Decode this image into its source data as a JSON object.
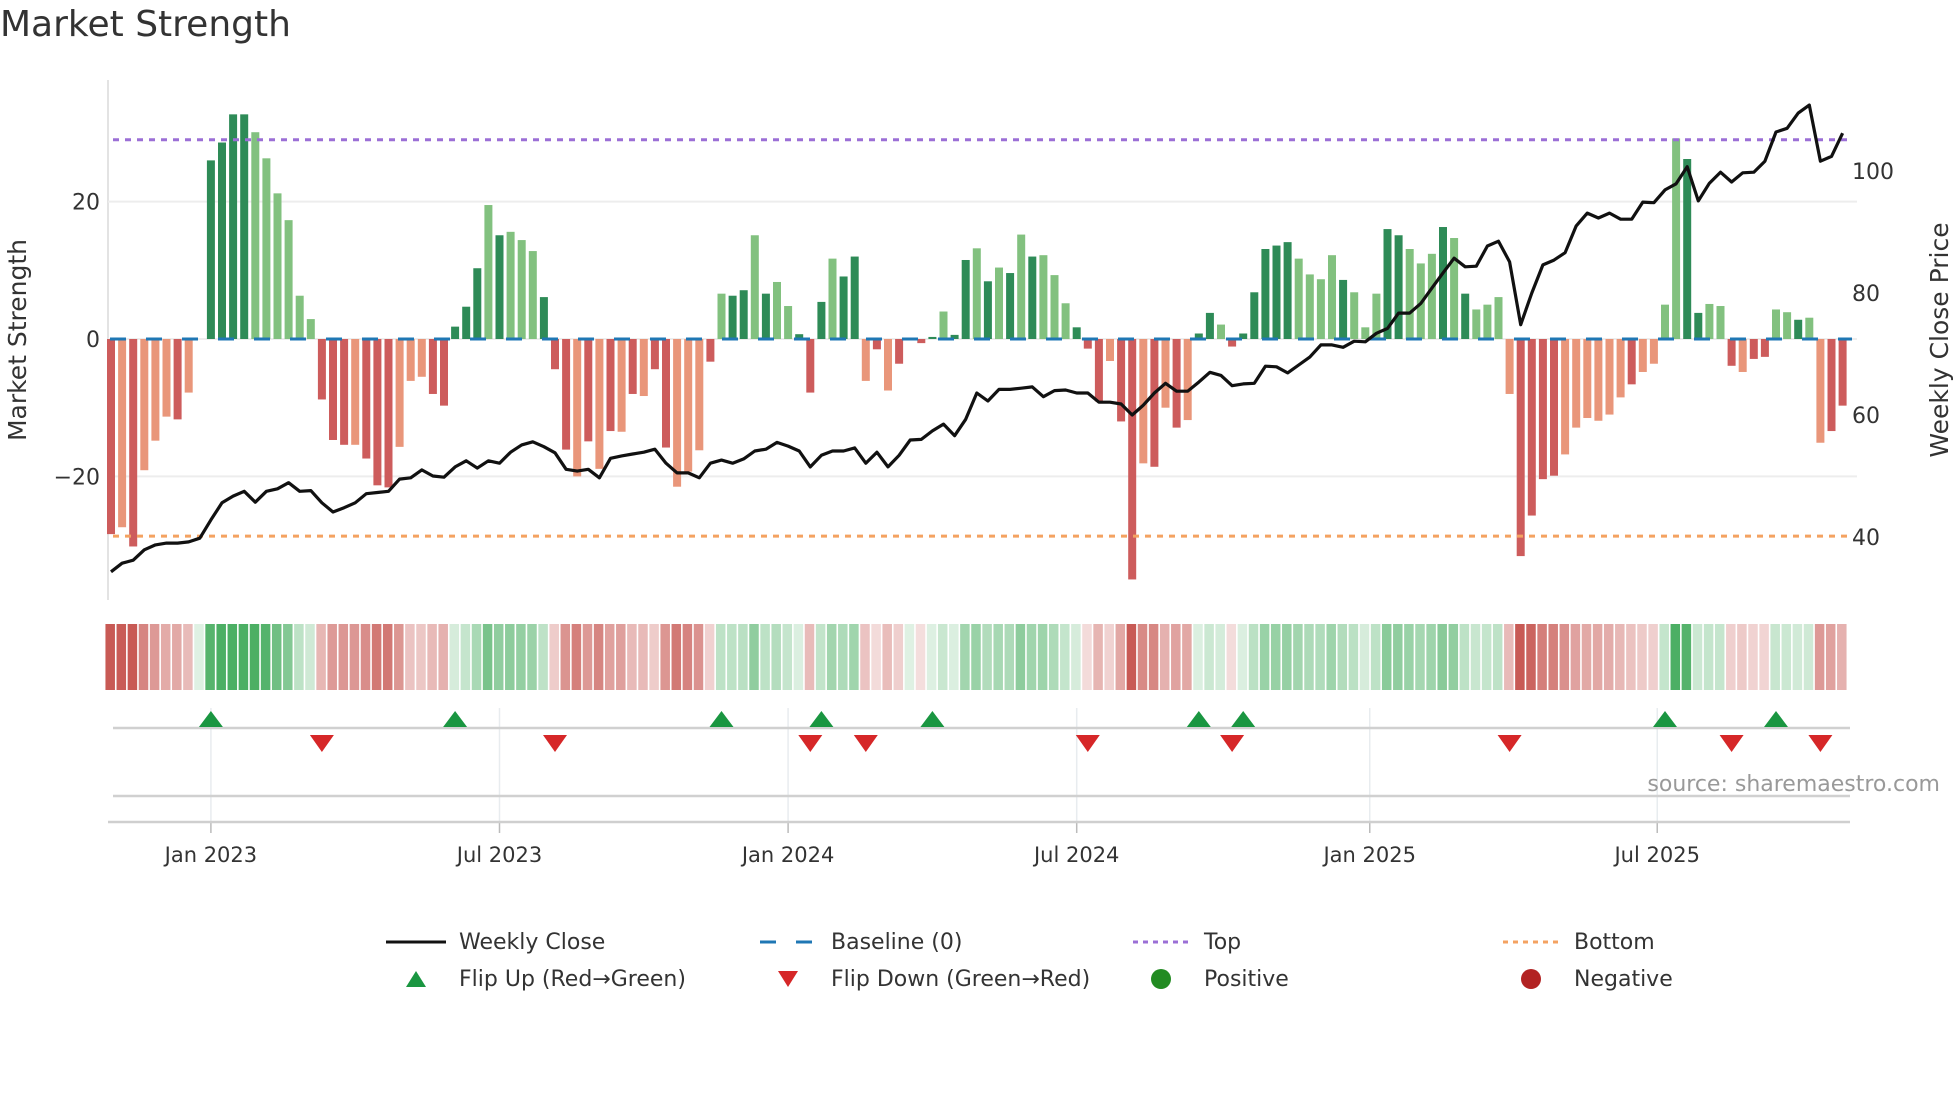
{
  "title": "Market Strength",
  "source": "source: sharemaestro.com",
  "colors": {
    "pos_dark": "#2e8b57",
    "pos_light": "#82c17f",
    "neg_dark": "#cd5c5c",
    "neg_light": "#e9967a",
    "baseline": "#1f77b4",
    "top": "#9b6fd6",
    "bottom": "#f4a261",
    "close": "#111111",
    "flip_up": "#1a9641",
    "flip_down": "#d62728",
    "positive": "#228b22",
    "negative": "#b22222"
  },
  "legend": [
    {
      "label": "Weekly Close",
      "symbol": "solid-line"
    },
    {
      "label": "Baseline (0)",
      "symbol": "dashed-line"
    },
    {
      "label": "Top",
      "symbol": "dotted-line-purple"
    },
    {
      "label": "Bottom",
      "symbol": "dotted-line-orange"
    },
    {
      "label": "Flip Up (Red→Green)",
      "symbol": "triangle-up"
    },
    {
      "label": "Flip Down (Green→Red)",
      "symbol": "triangle-down"
    },
    {
      "label": "Positive",
      "symbol": "circle-green"
    },
    {
      "label": "Negative",
      "symbol": "circle-red"
    }
  ],
  "chart_data": {
    "type": "bar+line",
    "title": "Market Strength",
    "x_unit": "week index (weekly bars, late Oct 2022 – late Oct 2025)",
    "x_ticks": [
      {
        "label": "Jan 2023",
        "x": 9
      },
      {
        "label": "Jul 2023",
        "x": 35
      },
      {
        "label": "Jan 2024",
        "x": 61
      },
      {
        "label": "Jul 2024",
        "x": 87
      },
      {
        "label": "Jan 2025",
        "x": 113.4
      },
      {
        "label": "Jul 2025",
        "x": 139.3
      }
    ],
    "y_left": {
      "label": "Market Strength",
      "range": [
        -38,
        37.4
      ],
      "ticks": [
        {
          "v": 20,
          "label": "20"
        },
        {
          "v": 0,
          "label": "0"
        },
        {
          "v": -20,
          "label": "−20"
        }
      ]
    },
    "y_right": {
      "label": "Weekly Close Price",
      "range": [
        29.7,
        114.6
      ],
      "ticks": [
        {
          "v": 100,
          "label": "100"
        },
        {
          "v": 80,
          "label": "80"
        },
        {
          "v": 60,
          "label": "60"
        },
        {
          "v": 40,
          "label": "40"
        }
      ]
    },
    "top_level": 29,
    "bottom_level": -28.7,
    "grid": true,
    "legend_placement": "bottom-center",
    "strength": [
      -28.4,
      -27.4,
      -30.2,
      -19.1,
      -14.8,
      -11.3,
      -11.7,
      -7.8,
      0,
      26.0,
      28.6,
      32.7,
      32.7,
      30.1,
      26.3,
      21.2,
      17.3,
      6.3,
      2.9,
      -8.8,
      -14.7,
      -15.4,
      -15.4,
      -17.4,
      -21.3,
      -21.6,
      -15.7,
      -6.1,
      -5.5,
      -8.0,
      -9.7,
      1.8,
      4.7,
      10.3,
      19.5,
      15.1,
      15.6,
      14.4,
      12.8,
      6.1,
      -4.4,
      -16.1,
      -20.0,
      -14.9,
      -18.9,
      -13.4,
      -13.5,
      -8.0,
      -8.3,
      -4.4,
      -15.8,
      -21.5,
      -19.3,
      -16.2,
      -3.3,
      6.6,
      6.3,
      7.1,
      15.1,
      6.6,
      8.3,
      4.8,
      0.7,
      -7.8,
      5.4,
      11.7,
      9.1,
      12.0,
      -6.1,
      -1.5,
      -7.5,
      -3.6,
      0,
      -0.6,
      0.3,
      4.0,
      0.6,
      11.5,
      13.2,
      8.4,
      10.4,
      9.6,
      15.2,
      12.0,
      12.2,
      9.3,
      5.2,
      1.7,
      -1.4,
      -9.1,
      -3.2,
      -12.0,
      -35.0,
      -18.1,
      -18.6,
      -10.0,
      -12.9,
      -11.8,
      0.8,
      3.8,
      2.1,
      -1.1,
      0.8,
      6.8,
      13.1,
      13.6,
      14.1,
      11.7,
      9.4,
      8.7,
      12.2,
      8.6,
      6.8,
      1.7,
      6.6,
      16.0,
      15.1,
      13.1,
      11.0,
      12.4,
      16.3,
      14.7,
      6.6,
      4.3,
      5.0,
      6.1,
      -8.0,
      -31.6,
      -25.7,
      -20.4,
      -19.9,
      -16.8,
      -12.9,
      -11.5,
      -11.9,
      -11.0,
      -8.5,
      -6.6,
      -4.8,
      -3.6,
      5.0,
      29.2,
      26.2,
      3.8,
      5.1,
      4.8,
      -3.9,
      -4.8,
      -2.9,
      -2.6,
      4.3,
      3.9,
      2.8,
      3.1,
      -15.1,
      -13.4,
      -9.7
    ],
    "shade": "dldllldl-ddddlllllldddldddllldddddldllldddldldldlddllldlddldlldddlddldl-dddlddldldldllldddlddldldlddlddddddlllldlllddllldldllllddddlllllldllllddlldlddlldllddll",
    "close": [
      34.3,
      35.7,
      36.2,
      37.9,
      38.7,
      39.0,
      39.0,
      39.2,
      39.8,
      42.8,
      45.6,
      46.7,
      47.5,
      45.7,
      47.5,
      47.9,
      48.9,
      47.5,
      47.6,
      45.6,
      44.1,
      44.8,
      45.6,
      47.1,
      47.3,
      47.5,
      49.5,
      49.7,
      51.0,
      50.0,
      49.8,
      51.5,
      52.5,
      51.3,
      52.5,
      52.1,
      53.9,
      55.1,
      55.6,
      54.8,
      53.8,
      51.1,
      50.8,
      51.1,
      49.7,
      52.9,
      53.3,
      53.6,
      53.9,
      54.4,
      52.1,
      50.5,
      50.5,
      49.7,
      52.1,
      52.6,
      52.1,
      52.8,
      54.1,
      54.4,
      55.5,
      54.9,
      54.1,
      51.5,
      53.4,
      54.1,
      54.1,
      54.6,
      52.1,
      53.9,
      51.5,
      53.4,
      55.9,
      56.0,
      57.4,
      58.5,
      56.6,
      59.3,
      63.6,
      62.3,
      64.2,
      64.2,
      64.4,
      64.6,
      63.0,
      64.0,
      64.1,
      63.6,
      63.6,
      62.1,
      62.1,
      61.8,
      60.0,
      61.6,
      63.6,
      65.2,
      63.9,
      63.9,
      65.4,
      67.0,
      66.5,
      64.8,
      65.1,
      65.2,
      68.0,
      67.9,
      66.9,
      68.2,
      69.5,
      71.5,
      71.5,
      71.1,
      72.1,
      72.0,
      73.4,
      74.2,
      76.7,
      76.7,
      78.3,
      80.8,
      83.3,
      85.7,
      84.3,
      84.4,
      87.7,
      88.5,
      85.1,
      74.8,
      80.0,
      84.6,
      85.4,
      86.6,
      91.0,
      93.1,
      92.3,
      93.1,
      92.1,
      92.1,
      94.9,
      94.8,
      96.9,
      97.9,
      100.7,
      95.1,
      98.0,
      99.8,
      98.2,
      99.7,
      99.8,
      101.6,
      106.4,
      107.0,
      109.5,
      110.8,
      101.6,
      102.4,
      106.2
    ],
    "flip_up": [
      9,
      31,
      55,
      64,
      74,
      98,
      102,
      140,
      150
    ],
    "flip_down": [
      19,
      40,
      63,
      68,
      88,
      101,
      126,
      146,
      154
    ]
  }
}
